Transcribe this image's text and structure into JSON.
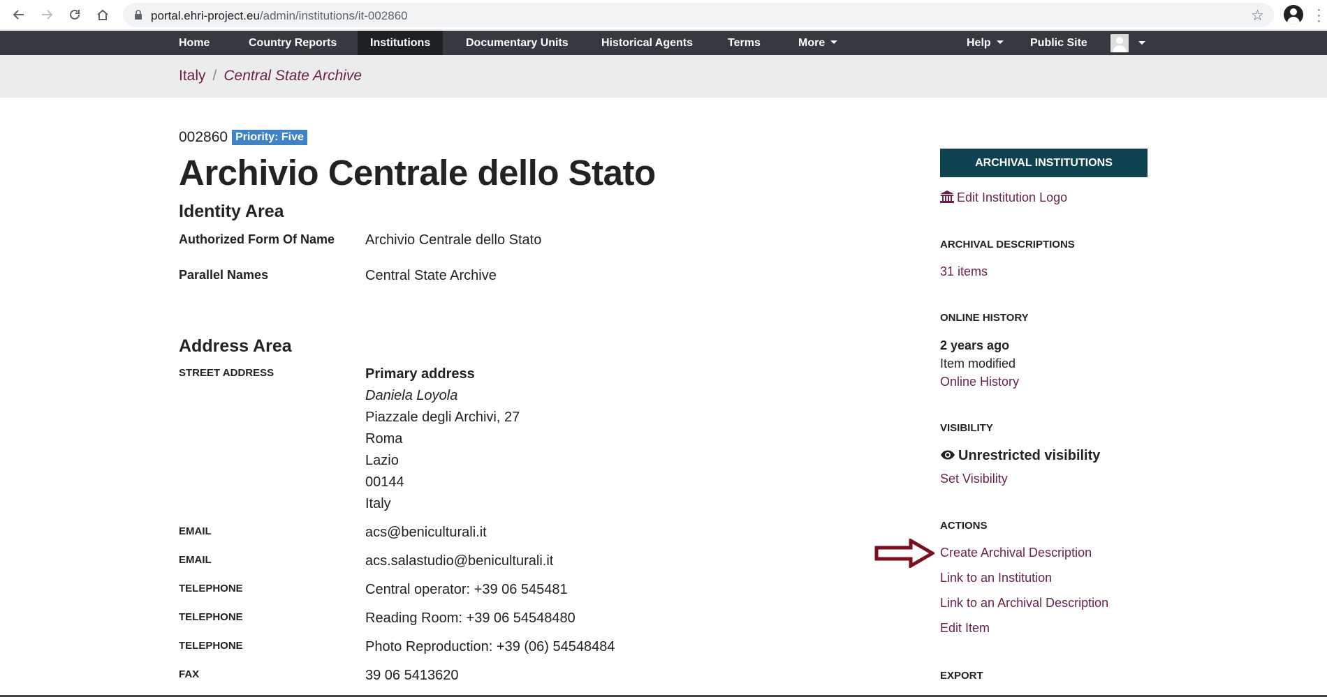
{
  "browser": {
    "url_host": "portal.ehri-project.eu",
    "url_path": "/admin/institutions/it-002860"
  },
  "nav": {
    "home": "Home",
    "country_reports": "Country Reports",
    "institutions": "Institutions",
    "documentary_units": "Documentary Units",
    "historical_agents": "Historical Agents",
    "terms": "Terms",
    "more": "More",
    "help": "Help",
    "public_site": "Public Site"
  },
  "breadcrumb": {
    "parent": "Italy",
    "separator": "/",
    "current": "Central State Archive"
  },
  "record": {
    "id": "002860",
    "priority": "Priority: Five",
    "title": "Archivio Centrale dello Stato"
  },
  "identity": {
    "heading": "Identity Area",
    "fields": [
      {
        "label": "Authorized Form Of Name",
        "value": "Archivio Centrale dello Stato"
      },
      {
        "label": "Parallel Names",
        "value": "Central State Archive"
      }
    ]
  },
  "address": {
    "heading": "Address Area",
    "street_label": "STREET ADDRESS",
    "lines": [
      "Primary address",
      "Daniela Loyola",
      "Piazzale degli Archivi, 27",
      "Roma",
      "Lazio",
      "00144",
      "Italy"
    ],
    "contacts": [
      {
        "label": "EMAIL",
        "value": "acs@beniculturali.it"
      },
      {
        "label": "EMAIL",
        "value": "acs.salastudio@beniculturali.it"
      },
      {
        "label": "TELEPHONE",
        "value": "Central operator: +39 06 545481"
      },
      {
        "label": "TELEPHONE",
        "value": "Reading Room: +39 06 54548480"
      },
      {
        "label": "TELEPHONE",
        "value": "Photo Reproduction: +39 (06) 54548484"
      },
      {
        "label": "FAX",
        "value": "39 06 5413620"
      }
    ]
  },
  "sidebar": {
    "button": "ARCHIVAL INSTITUTIONS",
    "edit_logo": "Edit Institution Logo",
    "descriptions_head": "ARCHIVAL DESCRIPTIONS",
    "descriptions_count": "31 items",
    "history_head": "ONLINE HISTORY",
    "history_time": "2 years ago",
    "history_event": "Item modified",
    "history_link": "Online History",
    "visibility_head": "VISIBILITY",
    "visibility_value": "Unrestricted visibility",
    "visibility_link": "Set Visibility",
    "actions_head": "ACTIONS",
    "actions": [
      "Create Archival Description",
      "Link to an Institution",
      "Link to an Archival Description",
      "Edit Item"
    ],
    "export_head": "EXPORT"
  },
  "colors": {
    "accent_link": "#6b1f4b",
    "navbar": "#343a40",
    "sidebar_button": "#0f4251",
    "badge": "#3e82c7",
    "arrow": "#7a0f1f"
  }
}
